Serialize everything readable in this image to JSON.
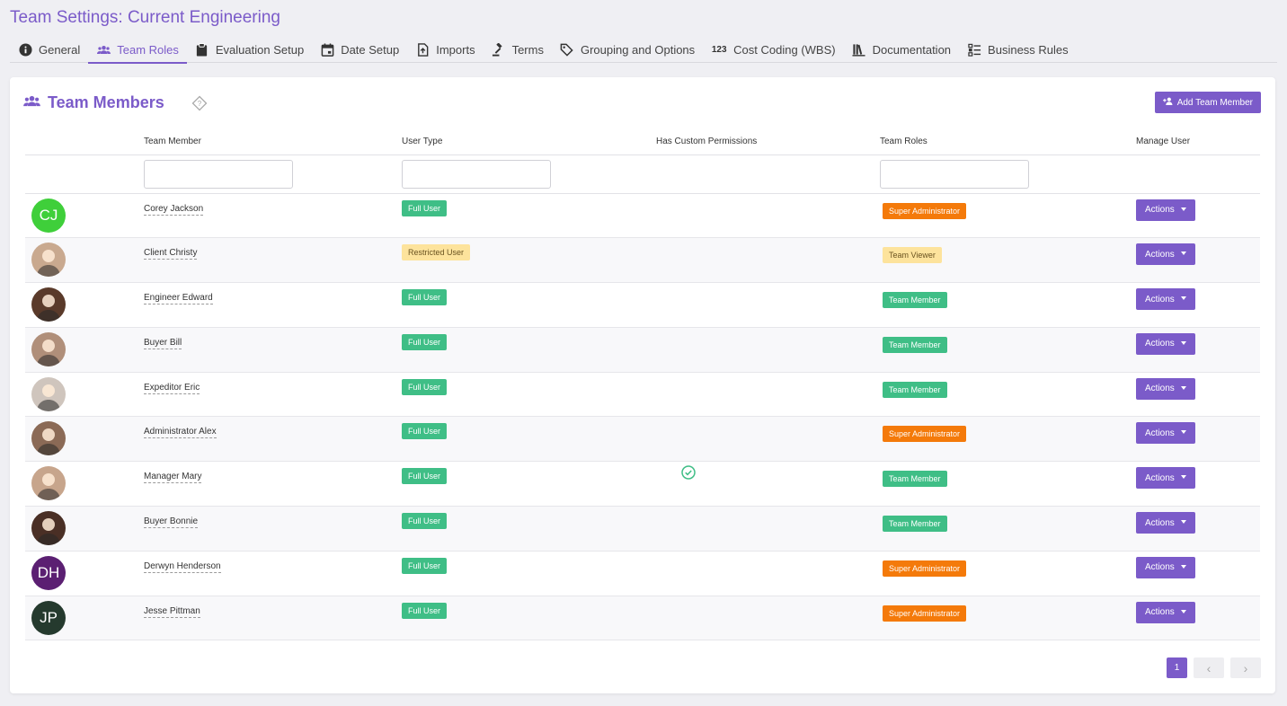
{
  "page": {
    "title": "Team Settings: Current Engineering"
  },
  "tabs": [
    {
      "label": "General",
      "icon": "info-icon"
    },
    {
      "label": "Team Roles",
      "icon": "users-icon",
      "active": true
    },
    {
      "label": "Evaluation Setup",
      "icon": "clipboard-icon"
    },
    {
      "label": "Date Setup",
      "icon": "calendar-icon"
    },
    {
      "label": "Imports",
      "icon": "import-file-icon"
    },
    {
      "label": "Terms",
      "icon": "gavel-icon"
    },
    {
      "label": "Grouping and Options",
      "icon": "tag-icon"
    },
    {
      "label": "Cost Coding (WBS)",
      "icon": "numbers-icon",
      "icon_text": "123"
    },
    {
      "label": "Documentation",
      "icon": "books-icon"
    },
    {
      "label": "Business Rules",
      "icon": "list-icon"
    }
  ],
  "card": {
    "title": "Team Members",
    "add_button": "Add Team Member"
  },
  "table": {
    "columns": [
      "Team Member",
      "User Type",
      "Has Custom Permissions",
      "Team Roles",
      "Manage User"
    ],
    "actions_label": "Actions",
    "rows": [
      {
        "name": "Corey Jackson",
        "initials": "CJ",
        "avatar_color": "#3fcf3a",
        "user_type": "Full User",
        "user_type_style": "green",
        "custom": false,
        "role": "Super Administrator",
        "role_style": "orange"
      },
      {
        "name": "Client Christy",
        "initials": "",
        "avatar_color": "#c9a98f",
        "user_type": "Restricted User",
        "user_type_style": "yellow",
        "custom": false,
        "role": "Team Viewer",
        "role_style": "yellow"
      },
      {
        "name": "Engineer Edward",
        "initials": "",
        "avatar_color": "#5a3a2a",
        "user_type": "Full User",
        "user_type_style": "green",
        "custom": false,
        "role": "Team Member",
        "role_style": "green"
      },
      {
        "name": "Buyer Bill",
        "initials": "",
        "avatar_color": "#b08f7a",
        "user_type": "Full User",
        "user_type_style": "green",
        "custom": false,
        "role": "Team Member",
        "role_style": "green"
      },
      {
        "name": "Expeditor Eric",
        "initials": "",
        "avatar_color": "#cfc5bd",
        "user_type": "Full User",
        "user_type_style": "green",
        "custom": false,
        "role": "Team Member",
        "role_style": "green"
      },
      {
        "name": "Administrator Alex",
        "initials": "",
        "avatar_color": "#8b6a56",
        "user_type": "Full User",
        "user_type_style": "green",
        "custom": false,
        "role": "Super Administrator",
        "role_style": "orange"
      },
      {
        "name": "Manager Mary",
        "initials": "",
        "avatar_color": "#c7a58c",
        "user_type": "Full User",
        "user_type_style": "green",
        "custom": true,
        "role": "Team Member",
        "role_style": "green"
      },
      {
        "name": "Buyer Bonnie",
        "initials": "",
        "avatar_color": "#4a2f25",
        "user_type": "Full User",
        "user_type_style": "green",
        "custom": false,
        "role": "Team Member",
        "role_style": "green"
      },
      {
        "name": "Derwyn Henderson",
        "initials": "DH",
        "avatar_color": "#5b1f72",
        "user_type": "Full User",
        "user_type_style": "green",
        "custom": false,
        "role": "Super Administrator",
        "role_style": "orange"
      },
      {
        "name": "Jesse Pittman",
        "initials": "JP",
        "avatar_color": "#253a2e",
        "user_type": "Full User",
        "user_type_style": "green",
        "custom": false,
        "role": "Super Administrator",
        "role_style": "orange"
      }
    ]
  },
  "pagination": {
    "current_page": "1",
    "prev": "‹",
    "next": "›"
  }
}
